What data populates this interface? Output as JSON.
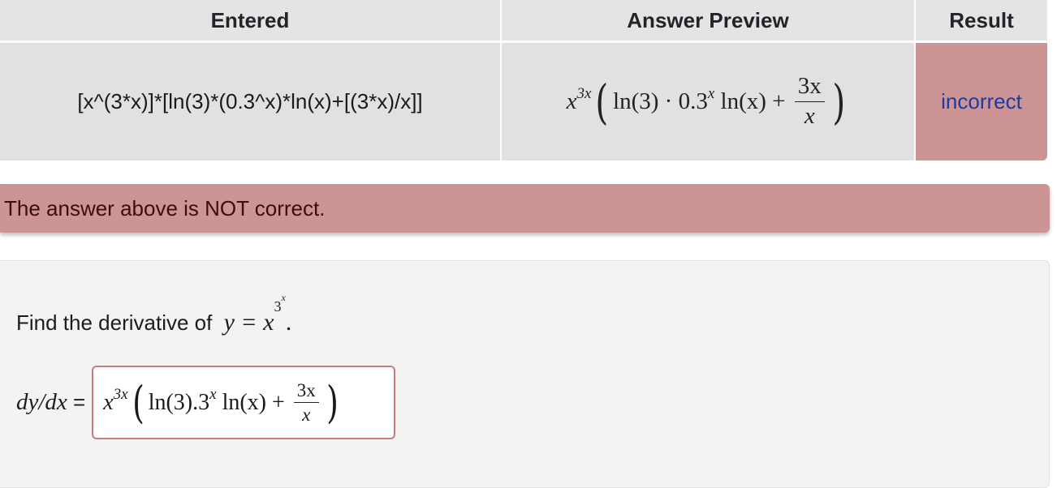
{
  "results_table": {
    "headers": [
      "Entered",
      "Answer Preview",
      "Result"
    ],
    "row": {
      "entered": "[x^(3*x)]*[ln(3)*(0.3^x)*ln(x)+[(3*x)/x]]",
      "preview": {
        "base": "x",
        "exponent": "3x",
        "inner_prefix": "ln(3) · 0.3",
        "inner_power": "x",
        "inner_suffix": " ln(x) + ",
        "fraction_num": "3x",
        "fraction_den": "x"
      },
      "result": "incorrect"
    }
  },
  "alert": {
    "message": "The answer above is NOT correct."
  },
  "problem": {
    "statement_text": "Find the derivative of ",
    "statement_math": {
      "lhs": "y = x",
      "exponent_base": "3",
      "exponent_power": "x",
      "trailing": "."
    },
    "answer_label_math": "dy/dx",
    "answer_label_eq": " =",
    "answer_field": {
      "base": "x",
      "exponent": "3x",
      "inner_prefix": "ln(3).3",
      "inner_power": "x",
      "inner_suffix": " ln(x) + ",
      "fraction_num": "3x",
      "fraction_den": "x"
    }
  },
  "colors": {
    "incorrect_bg": "#cc9494",
    "result_link": "#1a3aa7",
    "header_bg": "#e4e4e4",
    "panel_bg": "#f3f3f3"
  }
}
